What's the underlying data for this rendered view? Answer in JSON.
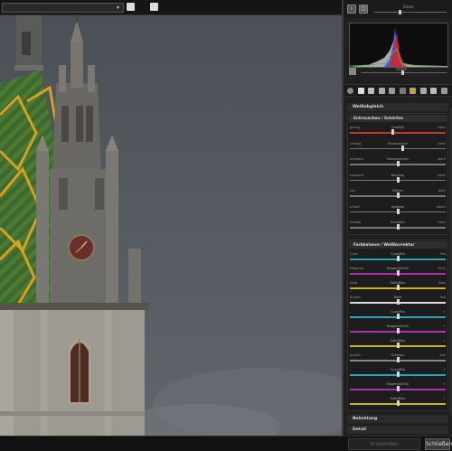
{
  "toolbar": {
    "path_value": "",
    "icons": [
      "chevron-down-icon",
      "layers-icon",
      "add-image-icon"
    ]
  },
  "panel_top": {
    "zoom_label": "Zoom",
    "size_label": "Größe",
    "icons": [
      "arrow-right-icon",
      "compare-icon",
      "grid-icon"
    ]
  },
  "tools": [
    "settings-icon",
    "crop-icon",
    "list-icon",
    "image-icon",
    "bw-icon",
    "circle-icon",
    "gradient-icon",
    "clone-icon",
    "photo-icon",
    "camera-icon"
  ],
  "sections": {
    "white_balance": "Weißabgleich",
    "denoise_sharpen": "Entrauschen / Schärfen",
    "color_balance": "Farbbalance / Weißkorrektur",
    "exposure": "Belichtung",
    "detail": "Detail"
  },
  "denoise_sliders": [
    {
      "left": "gering",
      "center": "Qualität",
      "right": "hoch",
      "value": 0.45,
      "color": "#c0392b"
    },
    {
      "left": "niedrig",
      "center": "Entrauschen",
      "right": "hoch",
      "value": 0.55,
      "color": "#777777"
    },
    {
      "left": "schwach",
      "center": "Farbrauschen",
      "right": "stark",
      "value": 0.5,
      "color": "#777777"
    },
    {
      "left": "schwach",
      "center": "Banding",
      "right": "stark",
      "value": 0.5,
      "color": "#777777"
    },
    {
      "left": "rau",
      "center": "Glätten",
      "right": "glatt",
      "value": 0.5,
      "color": "#777777"
    },
    {
      "left": "scharf",
      "center": "Hotpixel",
      "right": "weich",
      "value": 0.5,
      "color": "#777777"
    },
    {
      "left": "niedrig",
      "center": "Schärfen",
      "right": "hoch",
      "value": 0.5,
      "color": "#777777"
    }
  ],
  "color_sliders": [
    {
      "left": "Cyan",
      "center": "Cyan/Rot",
      "right": "Rot",
      "value": 0.5,
      "color": "#2aa6b8"
    },
    {
      "left": "Magenta",
      "center": "Magenta/Grün",
      "right": "Grün",
      "value": 0.5,
      "color": "#b030b0"
    },
    {
      "left": "Gelb",
      "center": "Gelb/Blau",
      "right": "Blau",
      "value": 0.5,
      "color": "#c8b030"
    },
    {
      "left": "dunkel",
      "center": "Weiß",
      "right": "hell",
      "value": 0.5,
      "color": "#dddddd"
    },
    {
      "left": "-",
      "center": "Cyan/Rot",
      "right": "+",
      "value": 0.5,
      "color": "#2aa6b8"
    },
    {
      "left": "-",
      "center": "Magenta/Grün",
      "right": "+",
      "value": 0.5,
      "color": "#b030b0"
    },
    {
      "left": "-",
      "center": "Gelb/Blau",
      "right": "+",
      "value": 0.5,
      "color": "#c8b030"
    },
    {
      "left": "dunkel",
      "center": "Schwarz",
      "right": "hell",
      "value": 0.5,
      "color": "#888888"
    },
    {
      "left": "-",
      "center": "Cyan/Rot",
      "right": "+",
      "value": 0.5,
      "color": "#2aa6b8"
    },
    {
      "left": "-",
      "center": "Magenta/Grün",
      "right": "+",
      "value": 0.5,
      "color": "#b030b0"
    },
    {
      "left": "-",
      "center": "Gelb/Blau",
      "right": "+",
      "value": 0.5,
      "color": "#c8b030"
    }
  ],
  "footer": {
    "apply_label": "Anwenden",
    "close_label": "Schließen"
  }
}
